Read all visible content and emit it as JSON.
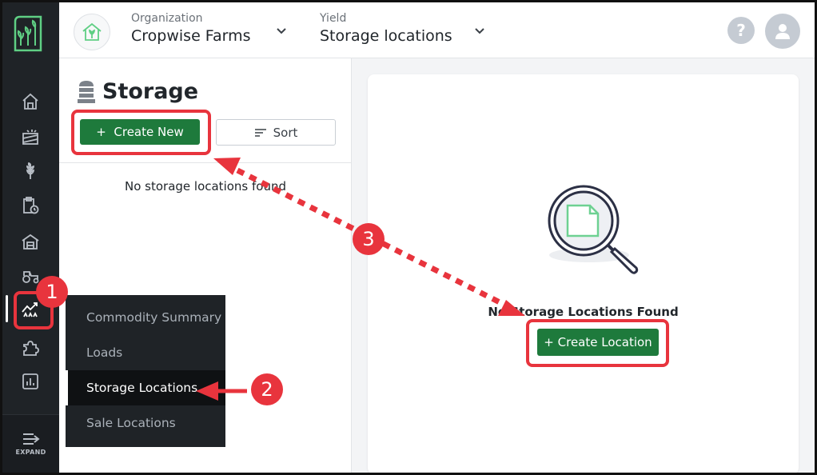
{
  "header": {
    "org_caption": "Organization",
    "org_value": "Cropwise Farms",
    "section_caption": "Yield",
    "section_value": "Storage locations",
    "help_label": "?"
  },
  "sidebar": {
    "expand_label": "EXPAND",
    "icons": [
      "home-icon",
      "field-icon",
      "crop-icon",
      "clipboard-clock-icon",
      "storage-building-icon",
      "tractor-icon",
      "yield-chart-icon",
      "puzzle-icon",
      "report-chart-icon"
    ]
  },
  "flyout": {
    "items": [
      {
        "label": "Commodity Summary"
      },
      {
        "label": "Loads"
      },
      {
        "label": "Storage Locations"
      },
      {
        "label": "Sale Locations"
      }
    ]
  },
  "storage_panel": {
    "title": "Storage",
    "create_new_label": "+  Create New",
    "sort_label": "Sort",
    "empty_message": "No storage locations found"
  },
  "detail_panel": {
    "empty_title": "No Storage Locations Found",
    "create_location_label": "+ Create Location"
  },
  "annotations": {
    "badges": [
      "1",
      "2",
      "3"
    ],
    "color": "#e8343d"
  },
  "colors": {
    "brand_green": "#1e7a3c",
    "sidebar_bg": "#1f2327"
  }
}
